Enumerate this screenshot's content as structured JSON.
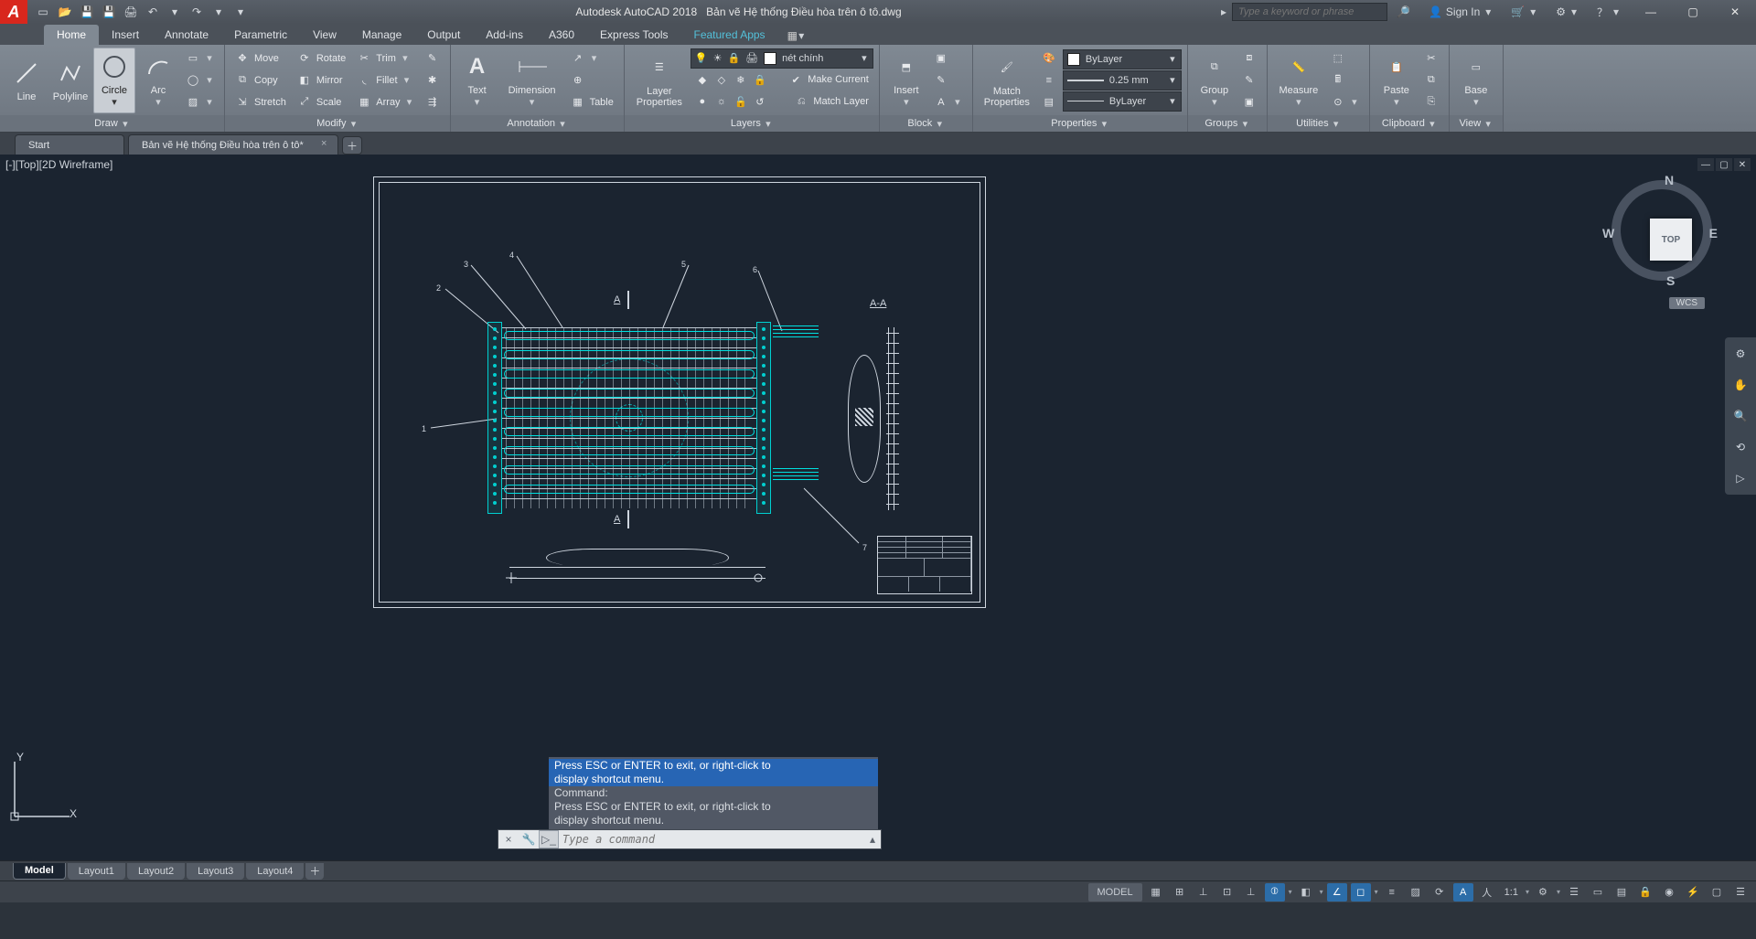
{
  "app": {
    "name": "Autodesk AutoCAD 2018",
    "document": "Bản vẽ Hệ thống Điều hòa trên ô tô.dwg",
    "search_placeholder": "Type a keyword or phrase",
    "signin": "Sign In"
  },
  "menutabs": [
    "Home",
    "Insert",
    "Annotate",
    "Parametric",
    "View",
    "Manage",
    "Output",
    "Add-ins",
    "A360",
    "Express Tools",
    "Featured Apps"
  ],
  "ribbon": {
    "draw": {
      "title": "Draw",
      "line": "Line",
      "polyline": "Polyline",
      "circle": "Circle",
      "arc": "Arc"
    },
    "modify": {
      "title": "Modify",
      "move": "Move",
      "rotate": "Rotate",
      "trim": "Trim",
      "copy": "Copy",
      "mirror": "Mirror",
      "fillet": "Fillet",
      "stretch": "Stretch",
      "scale": "Scale",
      "array": "Array"
    },
    "annotation": {
      "title": "Annotation",
      "text": "Text",
      "dimension": "Dimension",
      "table": "Table"
    },
    "layers": {
      "title": "Layers",
      "props": "Layer\nProperties",
      "current_layer": "nét chính",
      "make_current": "Make Current",
      "match": "Match Layer"
    },
    "block": {
      "title": "Block",
      "insert": "Insert"
    },
    "properties": {
      "title": "Properties",
      "match": "Match\nProperties",
      "layer": "ByLayer",
      "lineweight": "0.25 mm",
      "linetype": "ByLayer"
    },
    "groups": {
      "title": "Groups",
      "group": "Group"
    },
    "utilities": {
      "title": "Utilities",
      "measure": "Measure"
    },
    "clipboard": {
      "title": "Clipboard",
      "paste": "Paste"
    },
    "view": {
      "title": "View",
      "base": "Base"
    }
  },
  "filetabs": {
    "start": "Start",
    "doc": "Bản vẽ Hệ thống Điều hòa trên ô tô*"
  },
  "viewport": {
    "label": "[-][Top][2D Wireframe]",
    "cube_face": "TOP",
    "wcs": "WCS",
    "dirs": {
      "n": "N",
      "s": "S",
      "e": "E",
      "w": "W"
    }
  },
  "ucs": {
    "x": "X",
    "y": "Y"
  },
  "drawing": {
    "callouts": [
      "1",
      "2",
      "3",
      "4",
      "5",
      "6",
      "7"
    ],
    "section_a": "A",
    "section_aa": "A-A"
  },
  "cmd": {
    "history": [
      "Press ESC or ENTER to exit, or right-click to",
      "display shortcut menu.",
      "Command:",
      "Press ESC or ENTER to exit, or right-click to",
      "display shortcut menu."
    ],
    "placeholder": "Type a command"
  },
  "layouts": [
    "Model",
    "Layout1",
    "Layout2",
    "Layout3",
    "Layout4"
  ],
  "status": {
    "model": "MODEL",
    "scale": "1:1"
  }
}
